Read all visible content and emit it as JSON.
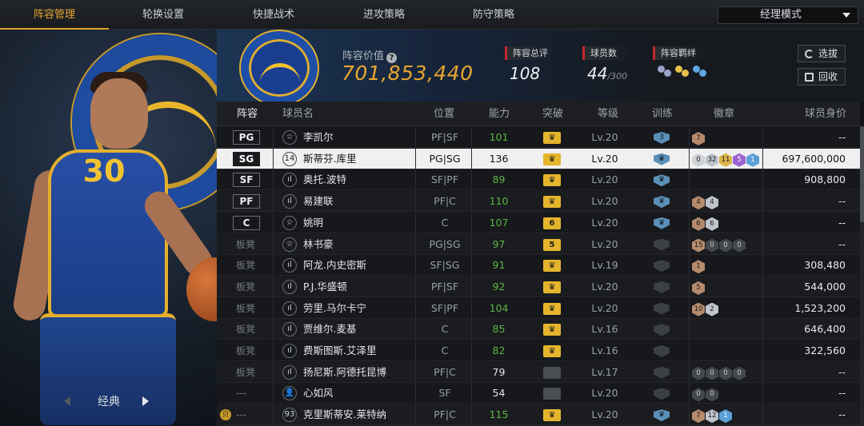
{
  "nav": {
    "tabs": [
      "阵容管理",
      "轮换设置",
      "快捷战术",
      "进攻策略",
      "防守策略"
    ],
    "active_tab": 0,
    "mode_select": "经理模式"
  },
  "left_panel": {
    "jersey_number": "30",
    "style_label": "经典"
  },
  "summary": {
    "value_label": "阵容价值",
    "value": "701,853,440",
    "total_rating_label": "阵容总评",
    "total_rating": "108",
    "player_count_label": "球员数",
    "player_count": "44",
    "player_count_max": "/300",
    "bond_label": "阵容羁绊",
    "buttons": [
      "选拔",
      "回收"
    ]
  },
  "table": {
    "headers": [
      "阵容",
      "球员名",
      "位置",
      "能力",
      "突破",
      "等级",
      "训练",
      "徽章",
      "球员身价"
    ],
    "rows": [
      {
        "slot": "PG",
        "starter": true,
        "role": "☆",
        "name": "李凯尔",
        "position": "PF|SF",
        "ability": "101",
        "ability_color": "green",
        "breakthrough": "♛",
        "bt_grey": false,
        "level": "Lv.20",
        "train": "3",
        "train_dim": false,
        "badges": [
          {
            "t": "br",
            "v": "7"
          }
        ],
        "price": "--"
      },
      {
        "slot": "SG",
        "starter": true,
        "role": "14",
        "name": "斯蒂芬.库里",
        "position": "PG|SG",
        "ability": "136",
        "ability_color": "white",
        "breakthrough": "♛",
        "bt_grey": false,
        "level": "Lv.20",
        "train": "♛",
        "train_dim": false,
        "badges": [
          {
            "t": "gr",
            "v": "0"
          },
          {
            "t": "si",
            "v": "32"
          },
          {
            "t": "go",
            "v": "11"
          },
          {
            "t": "pu",
            "v": "5"
          },
          {
            "t": "bl",
            "v": "1"
          }
        ],
        "price": "697,600,000"
      },
      {
        "slot": "SF",
        "starter": true,
        "role": "ıl",
        "name": "奥托.波特",
        "position": "SF|PF",
        "ability": "89",
        "ability_color": "green",
        "breakthrough": "♛",
        "bt_grey": false,
        "level": "Lv.20",
        "train": "♛",
        "train_dim": false,
        "badges": [],
        "price": "908,800"
      },
      {
        "slot": "PF",
        "starter": true,
        "role": "ıl",
        "name": "易建联",
        "position": "PF|C",
        "ability": "110",
        "ability_color": "green",
        "breakthrough": "♛",
        "bt_grey": false,
        "level": "Lv.20",
        "train": "♛",
        "train_dim": false,
        "badges": [
          {
            "t": "br",
            "v": "4"
          },
          {
            "t": "si",
            "v": "4"
          }
        ],
        "price": "--"
      },
      {
        "slot": "C",
        "starter": true,
        "role": "☆",
        "name": "姚明",
        "position": "C",
        "ability": "107",
        "ability_color": "green",
        "breakthrough": "6",
        "bt_grey": false,
        "level": "Lv.20",
        "train": "♛",
        "train_dim": false,
        "badges": [
          {
            "t": "br",
            "v": "6"
          },
          {
            "t": "si",
            "v": "6"
          }
        ],
        "price": "--"
      },
      {
        "slot": "板凳",
        "starter": false,
        "role": "☆",
        "name": "林书豪",
        "position": "PG|SG",
        "ability": "97",
        "ability_color": "green",
        "breakthrough": "5",
        "bt_grey": false,
        "level": "Lv.20",
        "train": "",
        "train_dim": true,
        "badges": [
          {
            "t": "br",
            "v": "15"
          },
          {
            "t": "dk",
            "v": "0"
          },
          {
            "t": "dk",
            "v": "0"
          },
          {
            "t": "dk",
            "v": "0"
          }
        ],
        "price": "--"
      },
      {
        "slot": "板凳",
        "starter": false,
        "role": "ıl",
        "name": "阿龙.内史密斯",
        "position": "SF|SG",
        "ability": "91",
        "ability_color": "green",
        "breakthrough": "♛",
        "bt_grey": false,
        "level": "Lv.19",
        "train": "",
        "train_dim": true,
        "badges": [
          {
            "t": "br",
            "v": "1"
          }
        ],
        "price": "308,480"
      },
      {
        "slot": "板凳",
        "starter": false,
        "role": "ıl",
        "name": "P.J.华盛顿",
        "position": "PF|SF",
        "ability": "92",
        "ability_color": "green",
        "breakthrough": "♛",
        "bt_grey": false,
        "level": "Lv.20",
        "train": "",
        "train_dim": true,
        "badges": [
          {
            "t": "br",
            "v": "5"
          }
        ],
        "price": "544,000"
      },
      {
        "slot": "板凳",
        "starter": false,
        "role": "ıl",
        "name": "劳里.马尔卡宁",
        "position": "SF|PF",
        "ability": "104",
        "ability_color": "green",
        "breakthrough": "♛",
        "bt_grey": false,
        "level": "Lv.20",
        "train": "",
        "train_dim": true,
        "badges": [
          {
            "t": "br",
            "v": "10"
          },
          {
            "t": "si",
            "v": "2"
          }
        ],
        "price": "1,523,200"
      },
      {
        "slot": "板凳",
        "starter": false,
        "role": "ıl",
        "name": "贾维尔.麦基",
        "position": "C",
        "ability": "85",
        "ability_color": "green",
        "breakthrough": "♛",
        "bt_grey": false,
        "level": "Lv.16",
        "train": "",
        "train_dim": true,
        "badges": [],
        "price": "646,400"
      },
      {
        "slot": "板凳",
        "starter": false,
        "role": "ıl",
        "name": "费斯图斯.艾泽里",
        "position": "C",
        "ability": "82",
        "ability_color": "green",
        "breakthrough": "♛",
        "bt_grey": false,
        "level": "Lv.16",
        "train": "",
        "train_dim": true,
        "badges": [],
        "price": "322,560"
      },
      {
        "slot": "板凳",
        "starter": false,
        "role": "ıl",
        "name": "扬尼斯.阿德托昆博",
        "position": "PF|C",
        "ability": "79",
        "ability_color": "white",
        "breakthrough": "",
        "bt_grey": true,
        "level": "Lv.17",
        "train": "",
        "train_dim": true,
        "badges": [
          {
            "t": "dk",
            "v": "0"
          },
          {
            "t": "dk",
            "v": "0"
          },
          {
            "t": "dk",
            "v": "0"
          },
          {
            "t": "dk",
            "v": "0"
          }
        ],
        "price": "--"
      },
      {
        "slot": "---",
        "starter": false,
        "role": "👤",
        "name": "心如风",
        "position": "SF",
        "ability": "54",
        "ability_color": "white",
        "breakthrough": "",
        "bt_grey": true,
        "level": "Lv.20",
        "train": "",
        "train_dim": true,
        "badges": [
          {
            "t": "dk",
            "v": "0"
          },
          {
            "t": "dk",
            "v": "0"
          }
        ],
        "price": "--"
      },
      {
        "slot": "---",
        "starter": false,
        "role": "93",
        "name": "克里斯蒂安.莱特纳",
        "position": "PF|C",
        "ability": "115",
        "ability_color": "green",
        "breakthrough": "♛",
        "bt_grey": false,
        "level": "Lv.20",
        "train": "♛",
        "train_dim": false,
        "badges": [
          {
            "t": "br",
            "v": "7"
          },
          {
            "t": "si",
            "v": "12"
          },
          {
            "t": "bl",
            "v": "1"
          }
        ],
        "price": "--",
        "coin": "贝"
      }
    ]
  },
  "colors": {
    "accent": "#e2a531",
    "ability_green": "#5db546",
    "selected_row_bg": "#f0f0f0",
    "stat_marker": "#c2282c"
  }
}
